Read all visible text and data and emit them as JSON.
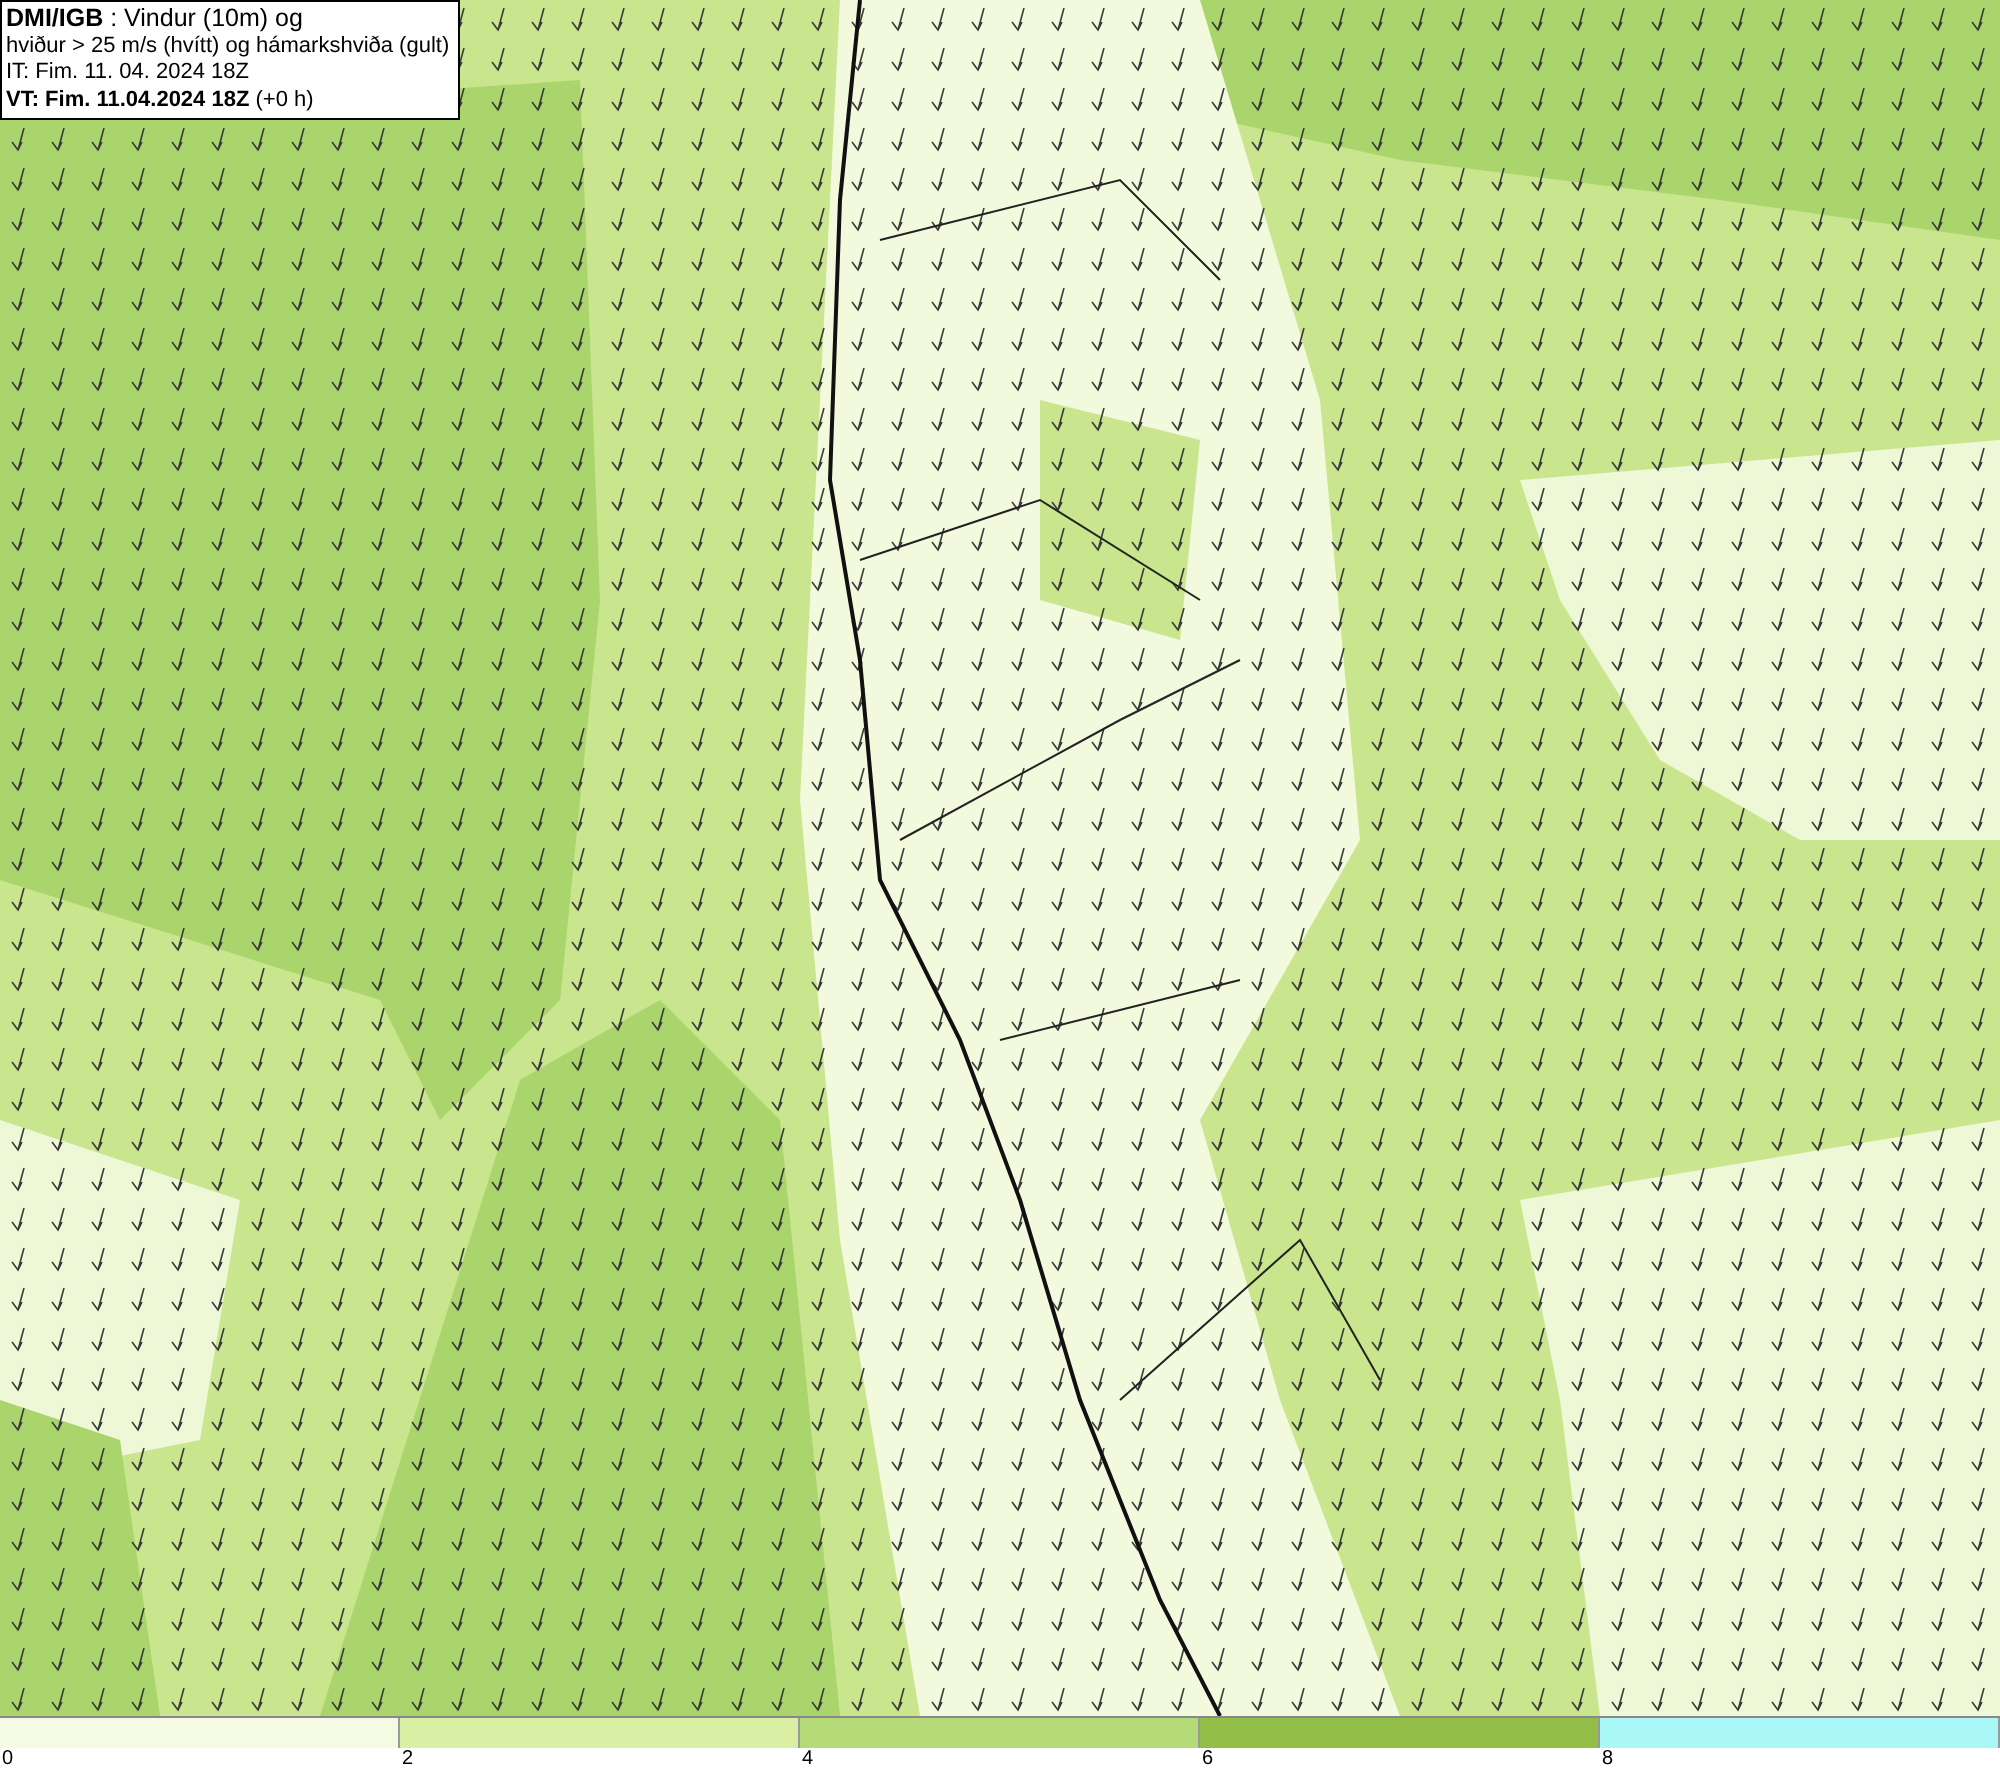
{
  "legend": {
    "lines": [
      "**DMI/IGB** : Vindur (10m) og",
      "hviður > 25 m/s (hvítt) og hámarkshviða (gult)",
      "IT: Fim. 11. 04. 2024 18Z",
      "**VT: Fim. 11.04.2024 18Z** (+0 h)"
    ]
  },
  "colorbar": {
    "segments": [
      {
        "color": "#f5fbe3"
      },
      {
        "color": "#d8efa4"
      },
      {
        "color": "#b5db78"
      },
      {
        "color": "#93bf48"
      },
      {
        "color": "#aaf7f7"
      }
    ],
    "ticks": [
      "0",
      "2",
      "4",
      "6",
      "8"
    ]
  }
}
